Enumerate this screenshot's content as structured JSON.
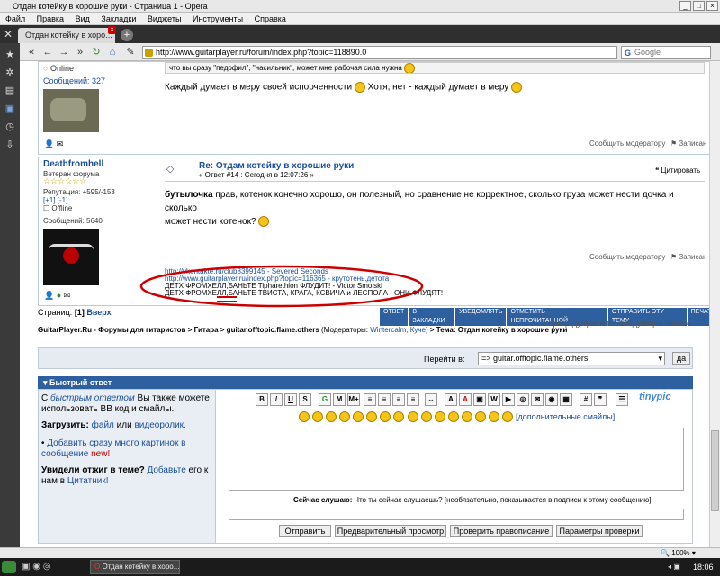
{
  "window": {
    "title": "Отдан котейку в хорошие руки - Страница 1 - Opera"
  },
  "menu": [
    "Файл",
    "Правка",
    "Вид",
    "Закладки",
    "Виджеты",
    "Инструменты",
    "Справка"
  ],
  "tab": {
    "label": "Отдан котейку в хоро..."
  },
  "address": {
    "url": "http://www.guitarplayer.ru/forum/index.php?topic=118890.0"
  },
  "search": {
    "placeholder": "Google"
  },
  "post1": {
    "status": "Online",
    "messages": "Сообщений: 327",
    "quote_tail": "что вы сразу \"педофил\", \"насильник\", может мне рабочая сила нужна",
    "text_a": "Каждый думает в меру своей испорченности",
    "text_b": "Хотя, нет - каждый думает в меру",
    "report": "Сообщить модератору",
    "logged": "Записан"
  },
  "post2": {
    "author": "Deathfromhell",
    "rank": "Ветеран форума",
    "stars": "☆☆☆☆☆☆",
    "reputation": "Репутация: +595/-153",
    "rep_links": "[+1] [-1]",
    "status": "Offline",
    "messages": "Сообщений: 5640",
    "title": "Re: Отдам котейку в хорошие руки",
    "subtitle": "« Ответ #14 : Сегодня в 12:07:26 »",
    "quote_btn": "Цитировать",
    "body_bold": "бутылочка",
    "body_rest": "прав, котенок конечно хорошо, он полезный, но сравнение не корректное, сколько груза может нести дочка и сколько",
    "body_line2": "может нести котенок?",
    "report": "Сообщить модератору",
    "logged": "Записан",
    "sig1": "http://vkontakte.ru/club8399145 - Severed Seconds",
    "sig2": "http://www.guitarplayer.ru/index.php?topic=116365 - крутотень.детота",
    "sig3": "ДЕТХ ФРОМХЕЛЛ,БАНЬТЕ Tipharethion ФЛУДИТ! - Victor Smolski",
    "sig4": "ДЕТХ ФРОМХЕЛЛ,БАНЬТЕ ТВИСТА, КРАГА, КСВИЧА и ЛЕСПОЛА - ОНИ ФЛУДЯТ!"
  },
  "pager": {
    "pages_label": "Страниц:",
    "current": "[1]",
    "up": "Вверх"
  },
  "actions": [
    "ОТВЕТ",
    "В ЗАКЛАДКИ",
    "УВЕДОМЛЯТЬ",
    "ОТМЕТИТЬ НЕПРОЧИТАННОЙ",
    "ОТПРАВИТЬ ЭТУ ТЕМУ",
    "ПЕЧАТЬ"
  ],
  "breadcrumb": {
    "path": "GuitarPlayer.Ru - Форумы для гитаристов > Гитара > guitar.offtopic.flame.others",
    "moderators_label": "(Модераторы:",
    "moderators": "Wintercalm, Куче)",
    "topic": "> Тема: Отдан котейку в хорошие руки",
    "prevnext": "« предыдущая тема следующая тема »"
  },
  "jump": {
    "label": "Перейти в:",
    "value": "=> guitar.offtopic.flame.others",
    "go": "да"
  },
  "quick": {
    "header": "Быстрый ответ",
    "help1": "С",
    "help_link": "быстрым ответом",
    "help2": "Вы также можете использовать BB код и смайлы.",
    "upload": "Загрузить:",
    "upload_file": "файл",
    "upload_or": "или",
    "upload_video": "видеоролик.",
    "add_pics": "Добавить сразу много картинок в сообщение",
    "new": "new!",
    "quote_lead": "Увидели отжиг в теме?",
    "quote_add": "Добавьте",
    "quote_mid": "его к нам в",
    "quote_link": "Цитатник!",
    "more_smiles": "[дополнительные смайлы]",
    "listening_label": "Сейчас слушаю:",
    "listening_hint": "Что ты сейчас слушаешь? [необязательно, показывается в подписи к этому сообщению]",
    "buttons": [
      "Отправить",
      "Предварительный просмотр",
      "Проверить правописание",
      "Параметры проверки"
    ]
  },
  "status": {
    "zoom": "100%"
  },
  "taskbar": {
    "item": "Отдан котейку в хоро...",
    "clock": "18:06"
  },
  "colors": {
    "accent": "#1a4e96",
    "annotation": "#cc0000",
    "header_bg": "#2e5f9e"
  }
}
